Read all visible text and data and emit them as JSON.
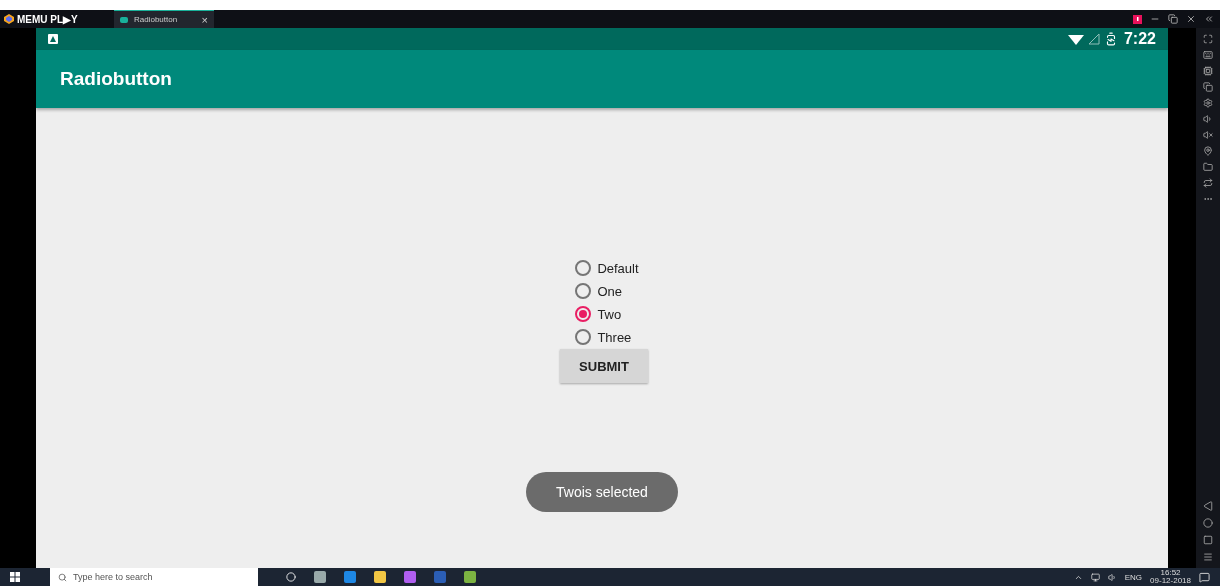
{
  "emulator": {
    "brand": "MEMU PL▶Y",
    "tab": {
      "label": "Radiobutton",
      "close": "×"
    }
  },
  "status_bar": {
    "time": "7:22"
  },
  "app_bar": {
    "title": "Radiobutton"
  },
  "radio_group": [
    {
      "label": "Default",
      "selected": false
    },
    {
      "label": "One",
      "selected": false
    },
    {
      "label": "Two",
      "selected": true
    },
    {
      "label": "Three",
      "selected": false
    }
  ],
  "submit_button": "SUBMIT",
  "toast": "Twois selected",
  "taskbar": {
    "search_placeholder": "Type here to search",
    "language": "ENG",
    "time": "16:52",
    "date": "09-12-2018"
  }
}
